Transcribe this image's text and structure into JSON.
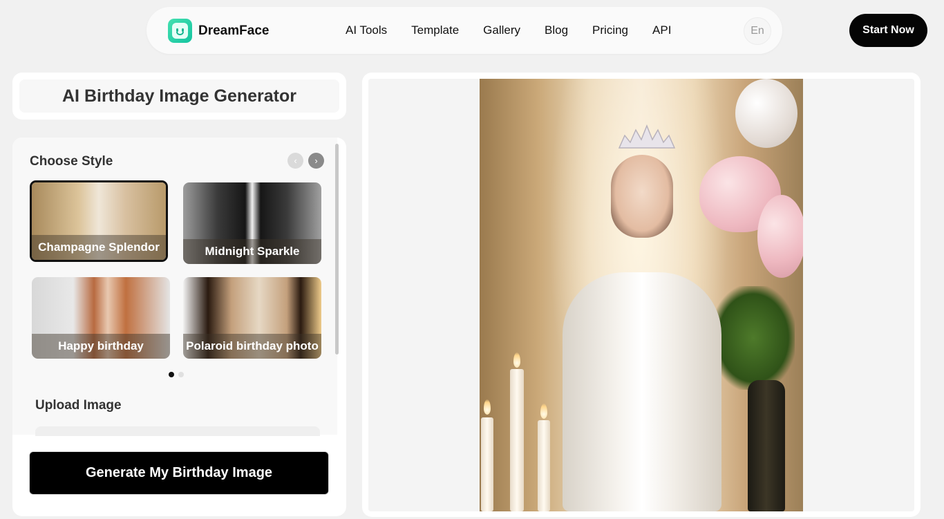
{
  "nav": {
    "brand": "DreamFace",
    "links": [
      "AI Tools",
      "Template",
      "Gallery",
      "Blog",
      "Pricing",
      "API"
    ],
    "lang": "En",
    "cta": "Start Now"
  },
  "page": {
    "title": "AI Birthday Image Generator"
  },
  "styles": {
    "section_title": "Choose Style",
    "items": [
      {
        "label": "Champagne Splendor",
        "selected": true
      },
      {
        "label": "Midnight Sparkle",
        "selected": false
      },
      {
        "label": "Happy birthday",
        "selected": false
      },
      {
        "label": "Polaroid birthday photo",
        "selected": false
      }
    ],
    "page_count": 2,
    "active_page": 1
  },
  "upload": {
    "section_title": "Upload Image"
  },
  "generate_button": "Generate My Birthday Image",
  "colors": {
    "accent": "#000000",
    "brand": "#1cc9a3"
  }
}
